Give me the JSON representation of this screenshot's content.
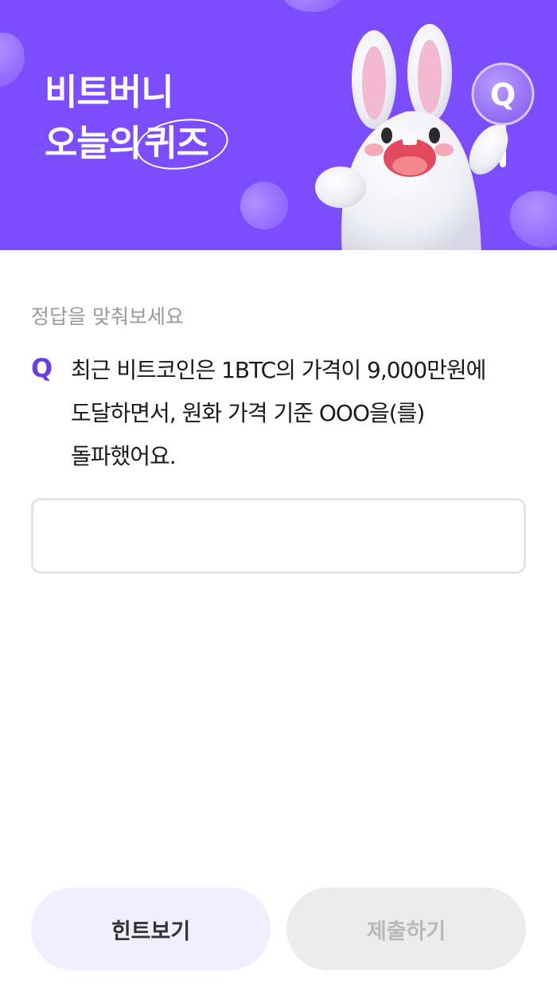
{
  "banner": {
    "title_line1": "비트버니",
    "title_line2_prefix": "오늘의",
    "title_line2_circled": "퀴즈",
    "background_color": "#7c4dff",
    "sign_letter": "Q"
  },
  "quiz": {
    "instruction": "정답을 맞춰보세요",
    "q_mark": "Q",
    "question": "최근 비트코인은 1BTC의 가격이 9,000만원에 도달하면서, 원화 가격 기준 OOO을(를) 돌파했어요.",
    "answer_value": "",
    "answer_placeholder": ""
  },
  "buttons": {
    "hint_label": "힌트보기",
    "submit_label": "제출하기"
  },
  "colors": {
    "accent": "#6a3de8",
    "hint_bg": "#f1eeff",
    "submit_bg_disabled": "#ececec"
  }
}
